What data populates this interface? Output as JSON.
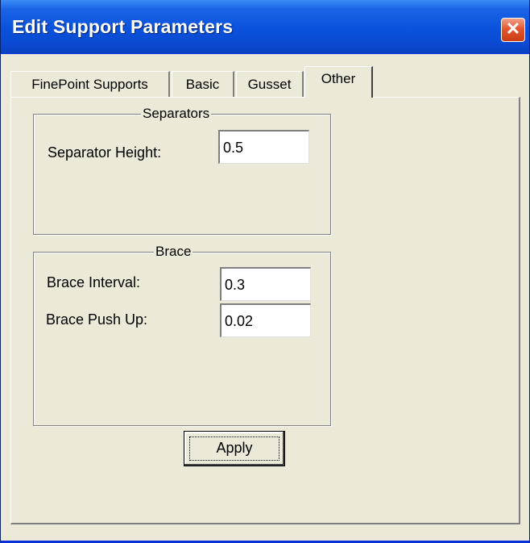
{
  "window": {
    "title": "Edit Support Parameters",
    "close_glyph": "✕"
  },
  "tabs": [
    {
      "label": "FinePoint Supports",
      "active": false
    },
    {
      "label": "Basic",
      "active": false
    },
    {
      "label": "Gusset",
      "active": false
    },
    {
      "label": "Other",
      "active": true
    }
  ],
  "separators": {
    "legend": "Separators",
    "separator_height_label": "Separator Height:",
    "separator_height_value": "0.5"
  },
  "brace": {
    "legend": "Brace",
    "interval_label": "Brace Interval:",
    "interval_value": "0.3",
    "push_up_label": "Brace Push Up:",
    "push_up_value": "0.02"
  },
  "apply_label": "Apply",
  "colors": {
    "dialog_bg": "#ece9d8",
    "titlebar": "#0a52dc",
    "close_button": "#e2582e"
  }
}
